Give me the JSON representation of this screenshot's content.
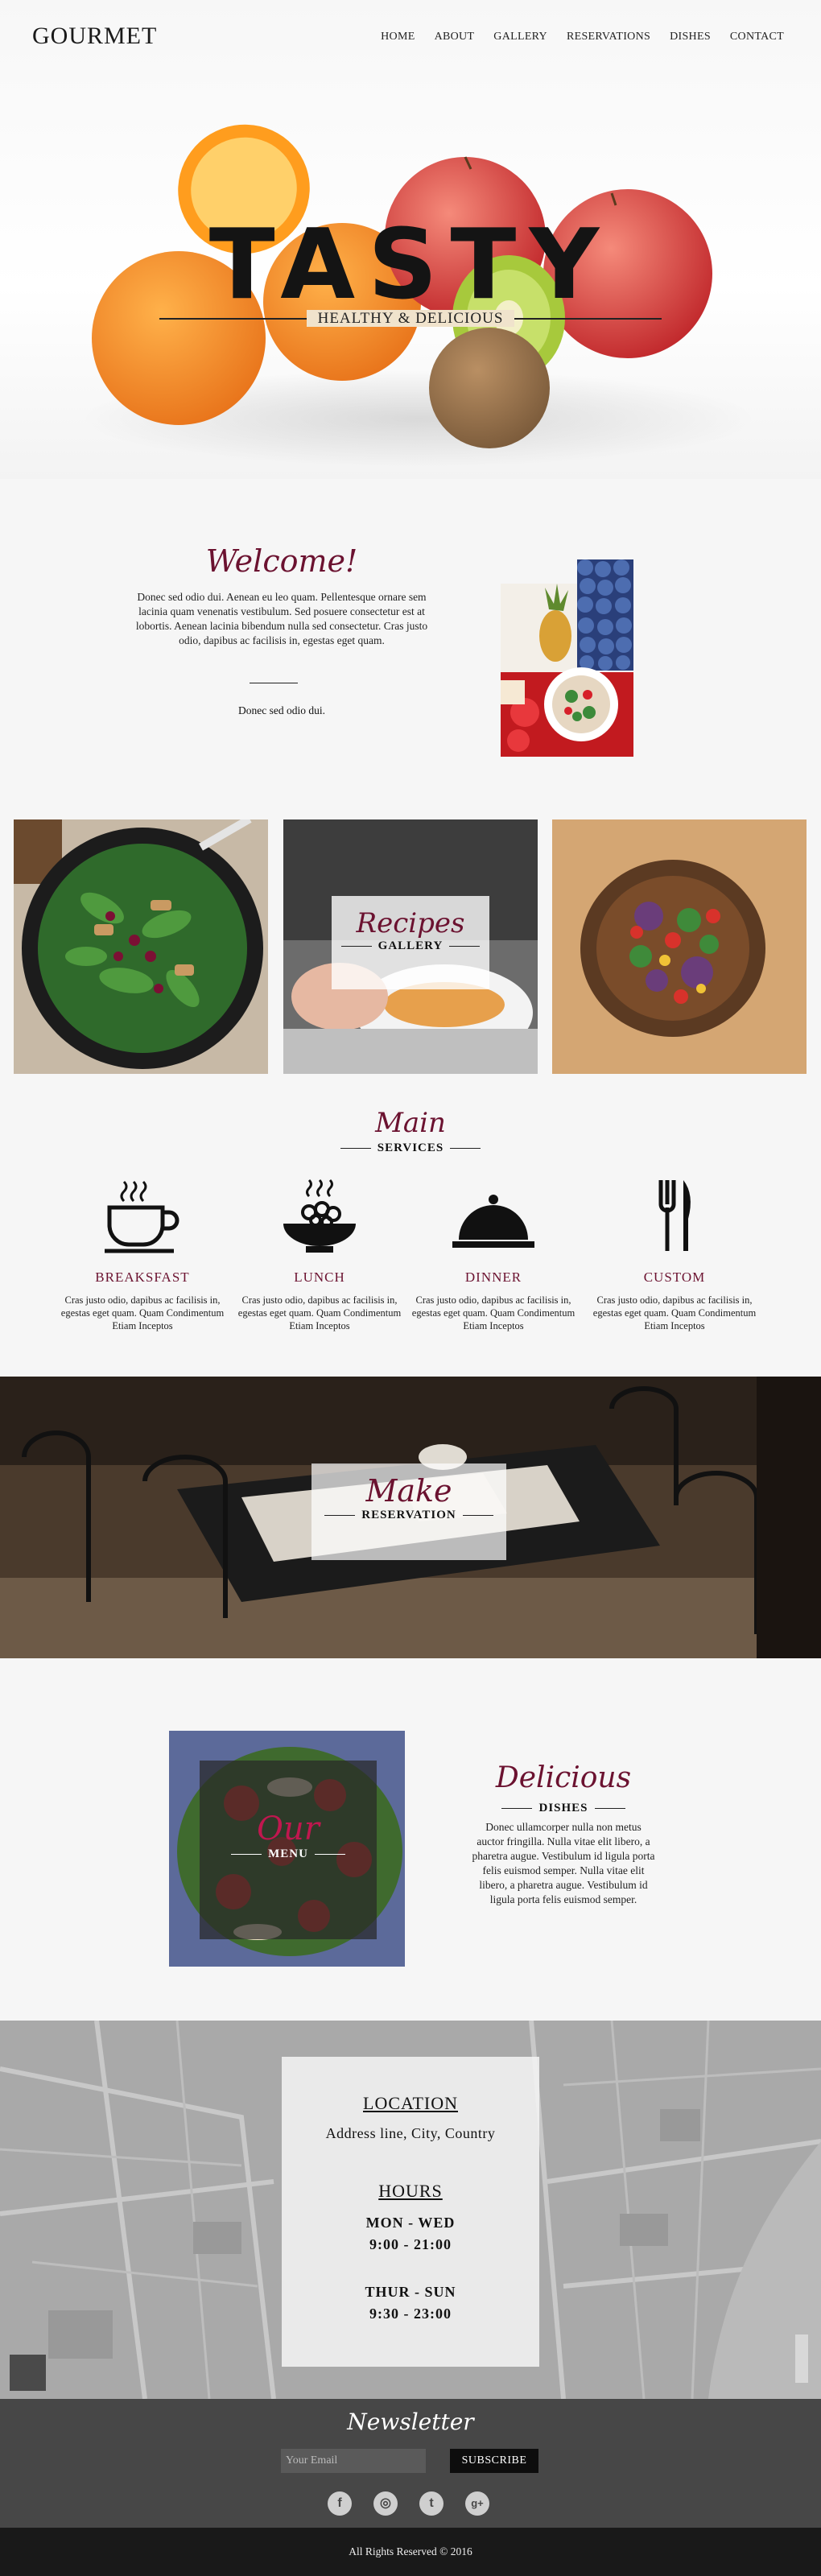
{
  "brand": "GOURMET",
  "nav": [
    "HOME",
    "ABOUT",
    "GALLERY",
    "RESERVATIONS",
    "DISHES",
    "CONTACT"
  ],
  "hero": {
    "title": "TASTY",
    "subtitle": "HEALTHY & DELICIOUS"
  },
  "welcome": {
    "title": "Welcome!",
    "text": "Donec sed odio dui. Aenean eu leo quam. Pellentesque ornare sem lacinia quam venenatis vestibulum. Sed posuere consectetur est at lobortis. Aenean lacinia bibendum nulla sed consectetur. Cras justo odio, dapibus ac facilisis in, egestas eget quam.",
    "small": "Donec sed odio dui."
  },
  "gallery": {
    "title": "Recipes",
    "subtitle": "GALLERY"
  },
  "services": {
    "title": "Main",
    "subtitle": "SERVICES",
    "items": [
      {
        "label": "BREAKSFAST",
        "icon": "coffee-cup-icon",
        "text": "Cras justo odio, dapibus ac facilisis in, egestas eget quam. Quam Condimentum Etiam Inceptos"
      },
      {
        "label": "LUNCH",
        "icon": "food-bowl-icon",
        "text": "Cras justo odio, dapibus ac facilisis in, egestas eget quam. Quam Condimentum Etiam Inceptos"
      },
      {
        "label": "DINNER",
        "icon": "cloche-icon",
        "text": "Cras justo odio, dapibus ac facilisis in, egestas eget quam. Quam Condimentum Etiam Inceptos"
      },
      {
        "label": "CUSTOM",
        "icon": "fork-knife-icon",
        "text": "Cras justo odio, dapibus ac facilisis in, egestas eget quam. Quam Condimentum Etiam Inceptos"
      }
    ]
  },
  "reservation": {
    "title": "Make",
    "subtitle": "RESERVATION"
  },
  "dishes": {
    "menu_title": "Our",
    "menu_subtitle": "MENU",
    "title": "Delicious",
    "subtitle": "DISHES",
    "text": "Donec ullamcorper nulla non metus auctor fringilla. Nulla vitae elit libero, a pharetra augue. Vestibulum id ligula porta felis euismod semper. Nulla vitae elit libero, a pharetra augue. Vestibulum id ligula porta felis euismod semper."
  },
  "location": {
    "heading": "LOCATION",
    "address": "Address line, City, Country",
    "hours_heading": "HOURS",
    "weekdays_label": "MON - WED",
    "weekdays_time": "9:00 - 21:00",
    "weekend_label": "THUR - SUN",
    "weekend_time": "9:30 - 23:00"
  },
  "newsletter": {
    "title": "Newsletter",
    "placeholder": "Your Email",
    "button": "SUBSCRIBE"
  },
  "social": [
    "f",
    "◎",
    "t",
    "g+"
  ],
  "footer": "All Rights Reserved © 2016"
}
